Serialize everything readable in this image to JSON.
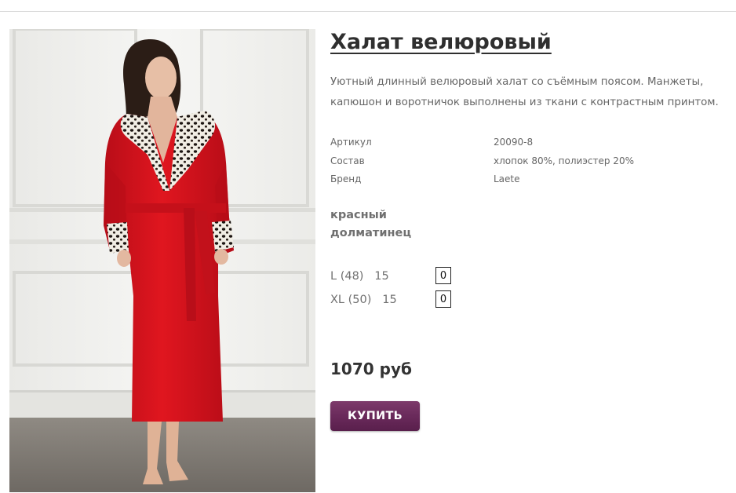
{
  "product": {
    "title": "Халат велюровый",
    "description": "Уютный длинный велюровый халат со съёмным поясом. Манжеты, капюшон и воротничок выполнены из ткани с контрастным принтом.",
    "specs": [
      {
        "label": "Артикул",
        "value": "20090-8"
      },
      {
        "label": "Состав",
        "value": "хлопок 80%, полиэстер 20%"
      },
      {
        "label": "Бренд",
        "value": "Laete"
      }
    ],
    "color_lines": [
      "красный",
      "долматинец"
    ],
    "sizes": [
      {
        "label": "L (48)   15",
        "quantity": "0"
      },
      {
        "label": "XL (50)   15",
        "quantity": "0"
      }
    ],
    "price": "1070 руб",
    "buy_label": "КУПИТЬ"
  },
  "colors": {
    "accent_button": "#6a2a5b",
    "robe": "#d7141f",
    "text_muted": "#666666"
  }
}
